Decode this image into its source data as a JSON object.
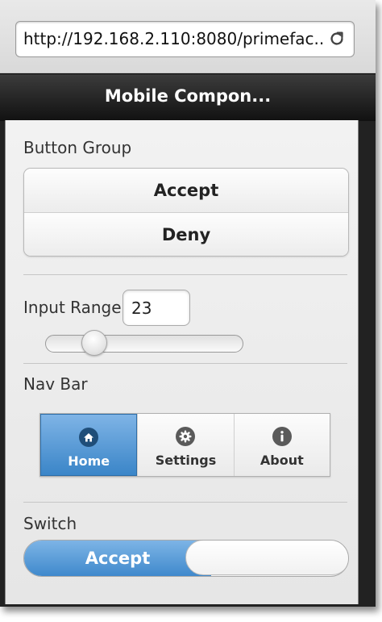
{
  "browser": {
    "url": "http://192.168.2.110:8080/primefac..."
  },
  "header": {
    "title": "Mobile Compon..."
  },
  "button_group": {
    "label": "Button Group",
    "buttons": [
      "Accept",
      "Deny"
    ]
  },
  "input_range": {
    "label": "Input Range",
    "value": "23",
    "slider_fraction": 0.23
  },
  "nav_bar": {
    "label": "Nav Bar",
    "items": [
      {
        "label": "Home",
        "icon": "home-icon",
        "active": true
      },
      {
        "label": "Settings",
        "icon": "gear-icon",
        "active": false
      },
      {
        "label": "About",
        "icon": "info-icon",
        "active": false
      }
    ]
  },
  "switch": {
    "label": "Switch",
    "on_label": "Accept",
    "state": "on"
  },
  "colors": {
    "accent": "#3a85c8",
    "header_bg": "#111111"
  }
}
